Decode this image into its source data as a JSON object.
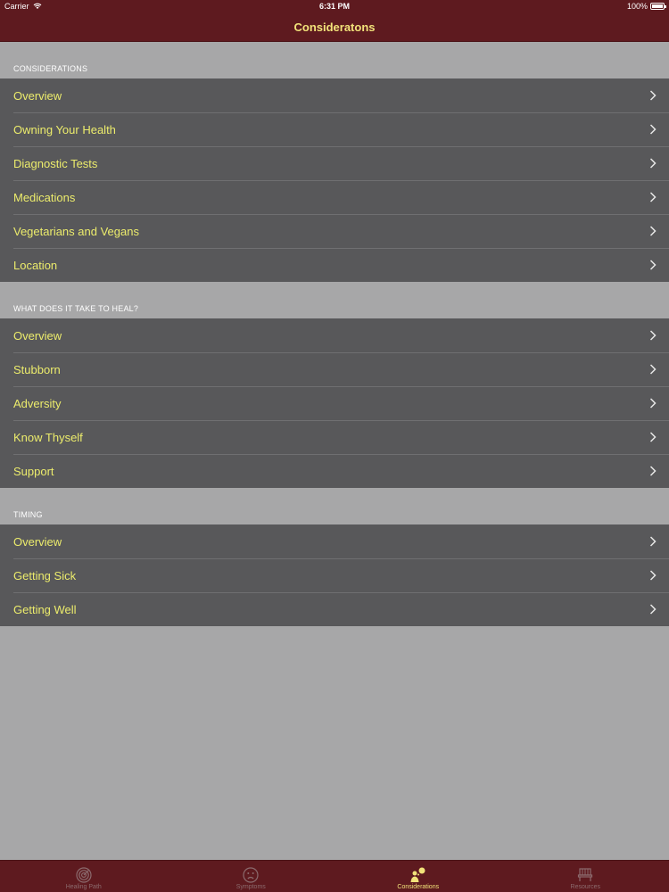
{
  "status_bar": {
    "carrier": "Carrier",
    "time": "6:31 PM",
    "battery": "100%"
  },
  "nav": {
    "title": "Consideratons"
  },
  "sections": [
    {
      "header": "CONSIDERATIONS",
      "items": [
        "Overview",
        "Owning Your Health",
        "Diagnostic Tests",
        "Medications",
        "Vegetarians and Vegans",
        "Location"
      ]
    },
    {
      "header": "WHAT DOES IT TAKE TO HEAL?",
      "items": [
        "Overview",
        "Stubborn",
        "Adversity",
        "Know Thyself",
        "Support"
      ]
    },
    {
      "header": "TIMING",
      "items": [
        "Overview",
        "Getting Sick",
        "Getting Well"
      ]
    }
  ],
  "tabs": [
    {
      "label": "Healing Path",
      "icon": "target-icon",
      "active": false
    },
    {
      "label": "Symptoms",
      "icon": "sad-face-icon",
      "active": false
    },
    {
      "label": "Considerations",
      "icon": "person-thought-icon",
      "active": true
    },
    {
      "label": "Resources",
      "icon": "bench-icon",
      "active": false
    }
  ],
  "colors": {
    "bar": "#5e1a1f",
    "row": "#58585a",
    "text_accent": "#ecec6c",
    "background": "#a7a7a8"
  }
}
